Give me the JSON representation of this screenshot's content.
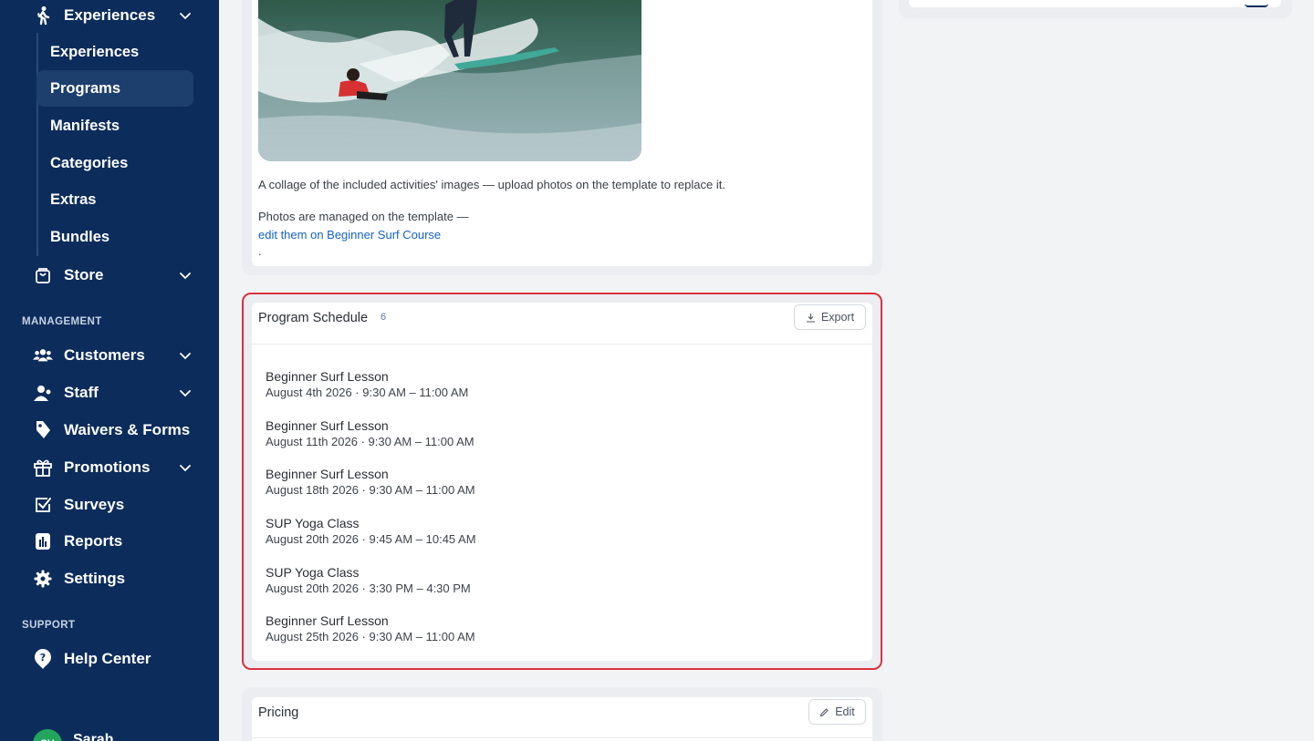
{
  "sidebar": {
    "experiences_group": "Experiences",
    "sub_items": [
      "Experiences",
      "Programs",
      "Manifests",
      "Categories",
      "Extras",
      "Bundles"
    ],
    "store": "Store",
    "management_label": "MANAGEMENT",
    "management_items": [
      "Customers",
      "Staff",
      "Waivers & Forms",
      "Promotions",
      "Surveys",
      "Reports",
      "Settings"
    ],
    "support_label": "SUPPORT",
    "help_center": "Help Center",
    "avatar_initials": "SU",
    "user_name": "Sarah"
  },
  "photos": {
    "caption": "A collage of the included activities' images — upload photos on the template to replace it.",
    "managed_text": "Photos are managed on the template —",
    "link_text": "edit them on Beginner Surf Course",
    "trailing": "."
  },
  "schedule": {
    "title": "Program Schedule",
    "count": "6",
    "export_label": "Export",
    "items": [
      {
        "name": "Beginner Surf Lesson",
        "time": "August 4th 2026 · 9:30 AM – 11:00 AM"
      },
      {
        "name": "Beginner Surf Lesson",
        "time": "August 11th 2026 · 9:30 AM – 11:00 AM"
      },
      {
        "name": "Beginner Surf Lesson",
        "time": "August 18th 2026 · 9:30 AM – 11:00 AM"
      },
      {
        "name": "SUP Yoga Class",
        "time": "August 20th 2026 · 9:45 AM – 10:45 AM"
      },
      {
        "name": "SUP Yoga Class",
        "time": "August 20th 2026 · 3:30 PM – 4:30 PM"
      },
      {
        "name": "Beginner Surf Lesson",
        "time": "August 25th 2026 · 9:30 AM – 11:00 AM"
      }
    ]
  },
  "pricing": {
    "title": "Pricing",
    "edit_label": "Edit"
  },
  "colors": {
    "sidebar_bg": "#0c2d5c",
    "active_item_bg": "#1c3f6e",
    "highlight_border": "#d8323f",
    "link": "#1463c9"
  }
}
